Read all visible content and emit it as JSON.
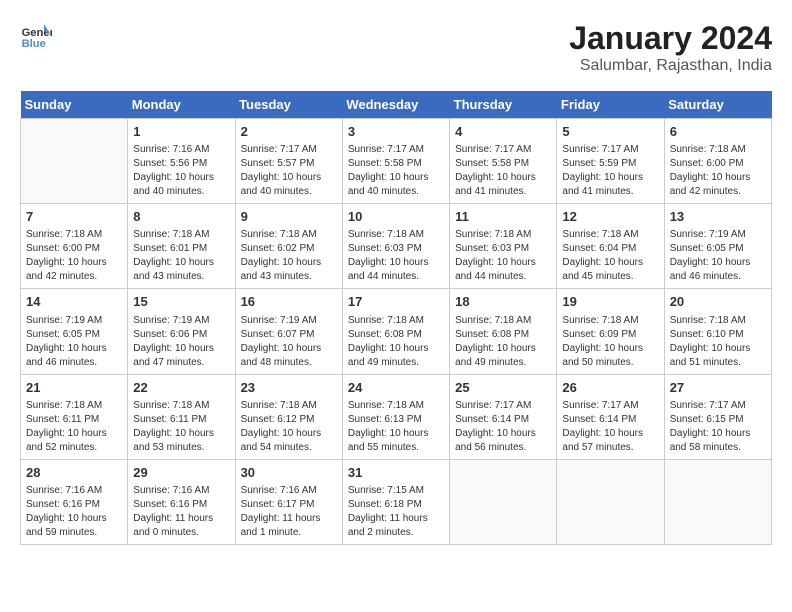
{
  "header": {
    "logo_line1": "General",
    "logo_line2": "Blue",
    "month_year": "January 2024",
    "location": "Salumbar, Rajasthan, India"
  },
  "weekdays": [
    "Sunday",
    "Monday",
    "Tuesday",
    "Wednesday",
    "Thursday",
    "Friday",
    "Saturday"
  ],
  "weeks": [
    [
      {
        "day": null,
        "info": null
      },
      {
        "day": "1",
        "info": "Sunrise: 7:16 AM\nSunset: 5:56 PM\nDaylight: 10 hours\nand 40 minutes."
      },
      {
        "day": "2",
        "info": "Sunrise: 7:17 AM\nSunset: 5:57 PM\nDaylight: 10 hours\nand 40 minutes."
      },
      {
        "day": "3",
        "info": "Sunrise: 7:17 AM\nSunset: 5:58 PM\nDaylight: 10 hours\nand 40 minutes."
      },
      {
        "day": "4",
        "info": "Sunrise: 7:17 AM\nSunset: 5:58 PM\nDaylight: 10 hours\nand 41 minutes."
      },
      {
        "day": "5",
        "info": "Sunrise: 7:17 AM\nSunset: 5:59 PM\nDaylight: 10 hours\nand 41 minutes."
      },
      {
        "day": "6",
        "info": "Sunrise: 7:18 AM\nSunset: 6:00 PM\nDaylight: 10 hours\nand 42 minutes."
      }
    ],
    [
      {
        "day": "7",
        "info": "Sunrise: 7:18 AM\nSunset: 6:00 PM\nDaylight: 10 hours\nand 42 minutes."
      },
      {
        "day": "8",
        "info": "Sunrise: 7:18 AM\nSunset: 6:01 PM\nDaylight: 10 hours\nand 43 minutes."
      },
      {
        "day": "9",
        "info": "Sunrise: 7:18 AM\nSunset: 6:02 PM\nDaylight: 10 hours\nand 43 minutes."
      },
      {
        "day": "10",
        "info": "Sunrise: 7:18 AM\nSunset: 6:03 PM\nDaylight: 10 hours\nand 44 minutes."
      },
      {
        "day": "11",
        "info": "Sunrise: 7:18 AM\nSunset: 6:03 PM\nDaylight: 10 hours\nand 44 minutes."
      },
      {
        "day": "12",
        "info": "Sunrise: 7:18 AM\nSunset: 6:04 PM\nDaylight: 10 hours\nand 45 minutes."
      },
      {
        "day": "13",
        "info": "Sunrise: 7:19 AM\nSunset: 6:05 PM\nDaylight: 10 hours\nand 46 minutes."
      }
    ],
    [
      {
        "day": "14",
        "info": "Sunrise: 7:19 AM\nSunset: 6:05 PM\nDaylight: 10 hours\nand 46 minutes."
      },
      {
        "day": "15",
        "info": "Sunrise: 7:19 AM\nSunset: 6:06 PM\nDaylight: 10 hours\nand 47 minutes."
      },
      {
        "day": "16",
        "info": "Sunrise: 7:19 AM\nSunset: 6:07 PM\nDaylight: 10 hours\nand 48 minutes."
      },
      {
        "day": "17",
        "info": "Sunrise: 7:18 AM\nSunset: 6:08 PM\nDaylight: 10 hours\nand 49 minutes."
      },
      {
        "day": "18",
        "info": "Sunrise: 7:18 AM\nSunset: 6:08 PM\nDaylight: 10 hours\nand 49 minutes."
      },
      {
        "day": "19",
        "info": "Sunrise: 7:18 AM\nSunset: 6:09 PM\nDaylight: 10 hours\nand 50 minutes."
      },
      {
        "day": "20",
        "info": "Sunrise: 7:18 AM\nSunset: 6:10 PM\nDaylight: 10 hours\nand 51 minutes."
      }
    ],
    [
      {
        "day": "21",
        "info": "Sunrise: 7:18 AM\nSunset: 6:11 PM\nDaylight: 10 hours\nand 52 minutes."
      },
      {
        "day": "22",
        "info": "Sunrise: 7:18 AM\nSunset: 6:11 PM\nDaylight: 10 hours\nand 53 minutes."
      },
      {
        "day": "23",
        "info": "Sunrise: 7:18 AM\nSunset: 6:12 PM\nDaylight: 10 hours\nand 54 minutes."
      },
      {
        "day": "24",
        "info": "Sunrise: 7:18 AM\nSunset: 6:13 PM\nDaylight: 10 hours\nand 55 minutes."
      },
      {
        "day": "25",
        "info": "Sunrise: 7:17 AM\nSunset: 6:14 PM\nDaylight: 10 hours\nand 56 minutes."
      },
      {
        "day": "26",
        "info": "Sunrise: 7:17 AM\nSunset: 6:14 PM\nDaylight: 10 hours\nand 57 minutes."
      },
      {
        "day": "27",
        "info": "Sunrise: 7:17 AM\nSunset: 6:15 PM\nDaylight: 10 hours\nand 58 minutes."
      }
    ],
    [
      {
        "day": "28",
        "info": "Sunrise: 7:16 AM\nSunset: 6:16 PM\nDaylight: 10 hours\nand 59 minutes."
      },
      {
        "day": "29",
        "info": "Sunrise: 7:16 AM\nSunset: 6:16 PM\nDaylight: 11 hours\nand 0 minutes."
      },
      {
        "day": "30",
        "info": "Sunrise: 7:16 AM\nSunset: 6:17 PM\nDaylight: 11 hours\nand 1 minute."
      },
      {
        "day": "31",
        "info": "Sunrise: 7:15 AM\nSunset: 6:18 PM\nDaylight: 11 hours\nand 2 minutes."
      },
      {
        "day": null,
        "info": null
      },
      {
        "day": null,
        "info": null
      },
      {
        "day": null,
        "info": null
      }
    ]
  ]
}
